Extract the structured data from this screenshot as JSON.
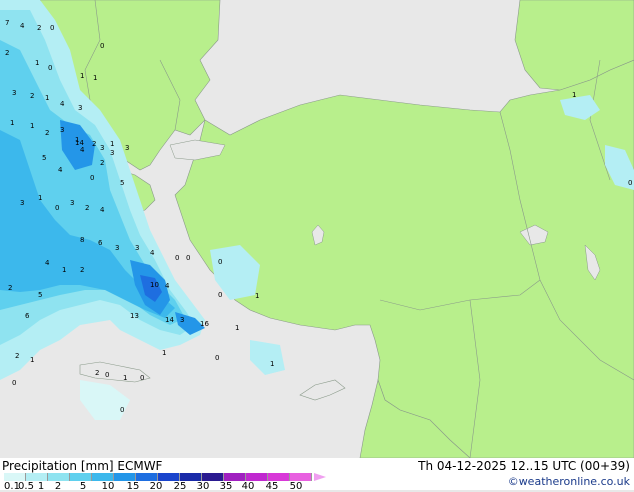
{
  "title": "Precipitation [mm] ECMWF",
  "datetime": "Th 04-12-2025 12..15 UTC (00+39)",
  "credit": "©weatheronline.co.uk",
  "legend": {
    "ticks": [
      "0.1",
      "0.5",
      "1",
      "2",
      "5",
      "10",
      "15",
      "20",
      "25",
      "30",
      "35",
      "40",
      "45",
      "50"
    ],
    "colors": [
      "#d9f7f7",
      "#b4eef4",
      "#8fe3f0",
      "#5fd0ee",
      "#3cb8ec",
      "#2496e8",
      "#1e6ee0",
      "#1a44cc",
      "#1a2aa8",
      "#2a1a90",
      "#a020c0",
      "#c028d0",
      "#d838d8",
      "#e860e0"
    ]
  },
  "map": {
    "land_color": "#b8ef8c",
    "sea_color": "#e8e8e8",
    "border_color": "#8a9a8a",
    "values": [
      "7",
      "4",
      "2",
      "0",
      "0",
      "2",
      "1",
      "0",
      "1",
      "1",
      "3",
      "2",
      "1",
      "4",
      "3",
      "1",
      "1",
      "2",
      "3",
      "5",
      "4",
      "3",
      "1",
      "1",
      "2",
      "14",
      "2",
      "3",
      "3",
      "4",
      "0",
      "5",
      "3",
      "1",
      "0",
      "3",
      "2",
      "4",
      "8",
      "6",
      "3",
      "3",
      "4",
      "4",
      "1",
      "2",
      "10",
      "4",
      "2",
      "5",
      "6",
      "13",
      "14",
      "3",
      "16",
      "1",
      "0",
      "0",
      "0",
      "1",
      "2",
      "1",
      "2",
      "0",
      "1",
      "0",
      "0",
      "0",
      "0",
      "1",
      "0",
      "1",
      "1",
      "0"
    ]
  }
}
